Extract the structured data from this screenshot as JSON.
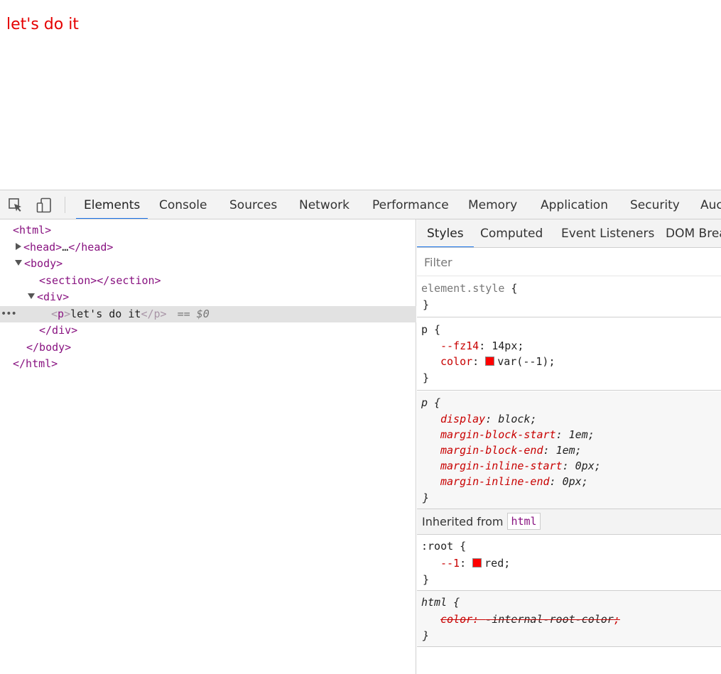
{
  "page": {
    "text": "let's do it",
    "text_color": "#e50000"
  },
  "toolbar": {
    "tabs": [
      {
        "label": "Elements",
        "active": true
      },
      {
        "label": "Console"
      },
      {
        "label": "Sources"
      },
      {
        "label": "Network"
      },
      {
        "label": "Performance"
      },
      {
        "label": "Memory"
      },
      {
        "label": "Application"
      },
      {
        "label": "Security"
      },
      {
        "label": "Auc"
      }
    ],
    "icons": [
      "inspect-cursor-icon",
      "device-toolbar-icon"
    ],
    "accent": "#1a73e8"
  },
  "dom": {
    "html_open": "<html>",
    "head_open": "<head>",
    "head_ellipsis": "…",
    "head_close": "</head>",
    "body_open": "<body>",
    "section_open": "<section>",
    "section_close": "</section>",
    "div_open": "<div>",
    "p_lt": "<",
    "p_name": "p",
    "p_gt": ">",
    "p_text": "let's do it",
    "p_close": "</p>",
    "selected_marker": "== $0",
    "div_close": "</div>",
    "body_close": "</body>",
    "html_close": "</html>",
    "ellipsis_button": "•••"
  },
  "styles": {
    "subtabs": [
      {
        "label": "Styles",
        "active": true
      },
      {
        "label": "Computed"
      },
      {
        "label": "Event Listeners"
      },
      {
        "label": "DOM Brea"
      }
    ],
    "filter_placeholder": "Filter",
    "element_style": {
      "selector": "element.style",
      "open": " {",
      "close": "}"
    },
    "rule_p_author": {
      "selector": "p",
      "open": " {",
      "close": "}",
      "decl1": {
        "prop": "--fz14",
        "colon": ": ",
        "value": "14px",
        "semi": ";"
      },
      "decl2": {
        "prop": "color",
        "colon": ": ",
        "value": "var(--1)",
        "semi": ";"
      }
    },
    "rule_p_ua": {
      "selector": "p",
      "open": " {",
      "close": "}",
      "decl1": {
        "prop": "display",
        "colon": ": ",
        "value": "block",
        "semi": ";"
      },
      "decl2": {
        "prop": "margin-block-start",
        "colon": ": ",
        "value": "1em",
        "semi": ";"
      },
      "decl3": {
        "prop": "margin-block-end",
        "colon": ": ",
        "value": "1em",
        "semi": ";"
      },
      "decl4": {
        "prop": "margin-inline-start",
        "colon": ": ",
        "value": "0px",
        "semi": ";"
      },
      "decl5": {
        "prop": "margin-inline-end",
        "colon": ": ",
        "value": "0px",
        "semi": ";"
      }
    },
    "inherited": {
      "label": "Inherited from",
      "chip": "html"
    },
    "rule_root": {
      "selector": ":root",
      "open": " {",
      "close": "}",
      "decl1": {
        "prop": "--1",
        "colon": ": ",
        "value": "red",
        "semi": ";"
      }
    },
    "rule_html_ua": {
      "selector": "html",
      "open": " {",
      "close": "}",
      "decl1": {
        "prop": "color",
        "colon": ": ",
        "value": "-internal-root-color",
        "semi": ";"
      }
    },
    "swatch_color": "#ff0000"
  }
}
